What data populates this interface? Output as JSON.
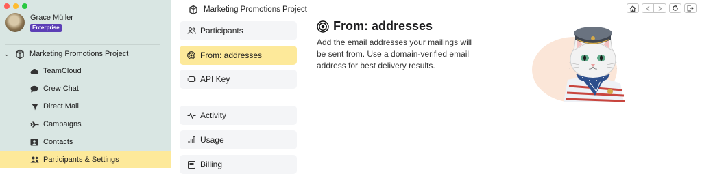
{
  "window": {
    "controls": [
      {
        "name": "close",
        "color": "#ff5f57"
      },
      {
        "name": "minimize",
        "color": "#febc2e"
      },
      {
        "name": "zoom",
        "color": "#28c840"
      }
    ]
  },
  "user": {
    "name": "Grace Müller",
    "plan": "Enterprise"
  },
  "sidebar": {
    "project": "Marketing Promotions Project",
    "items": [
      {
        "label": "TeamCloud",
        "icon": "cloud-icon"
      },
      {
        "label": "Crew Chat",
        "icon": "chat-bubble-icon"
      },
      {
        "label": "Direct Mail",
        "icon": "paper-plane-icon"
      },
      {
        "label": "Campaigns",
        "icon": "airplane-icon"
      },
      {
        "label": "Contacts",
        "icon": "contact-card-icon"
      },
      {
        "label": "Participants & Settings",
        "icon": "people-icon",
        "active": true
      }
    ]
  },
  "header": {
    "title": "Marketing Promotions Project",
    "buttons": [
      "home-icon",
      "back-icon",
      "forward-icon",
      "refresh-icon",
      "exit-icon"
    ]
  },
  "menu": {
    "items": [
      {
        "label": "Participants",
        "icon": "participants-icon"
      },
      {
        "label": "From: addresses",
        "icon": "target-icon",
        "active": true
      },
      {
        "label": "API Key",
        "icon": "key-icon"
      },
      {
        "label": "Activity",
        "icon": "pulse-icon"
      },
      {
        "label": "Usage",
        "icon": "bar-chart-icon"
      },
      {
        "label": "Billing",
        "icon": "billing-icon"
      }
    ]
  },
  "content": {
    "title": "From: addresses",
    "description": "Add the email addresses your mailings will be sent from. Use a domain-verified email address for best delivery results."
  },
  "colors": {
    "sidebar_bg": "#d9e6e3",
    "active_bg": "#fde99a",
    "badge_bg": "#5c3fb6",
    "menu_bg": "#f4f5f7"
  }
}
